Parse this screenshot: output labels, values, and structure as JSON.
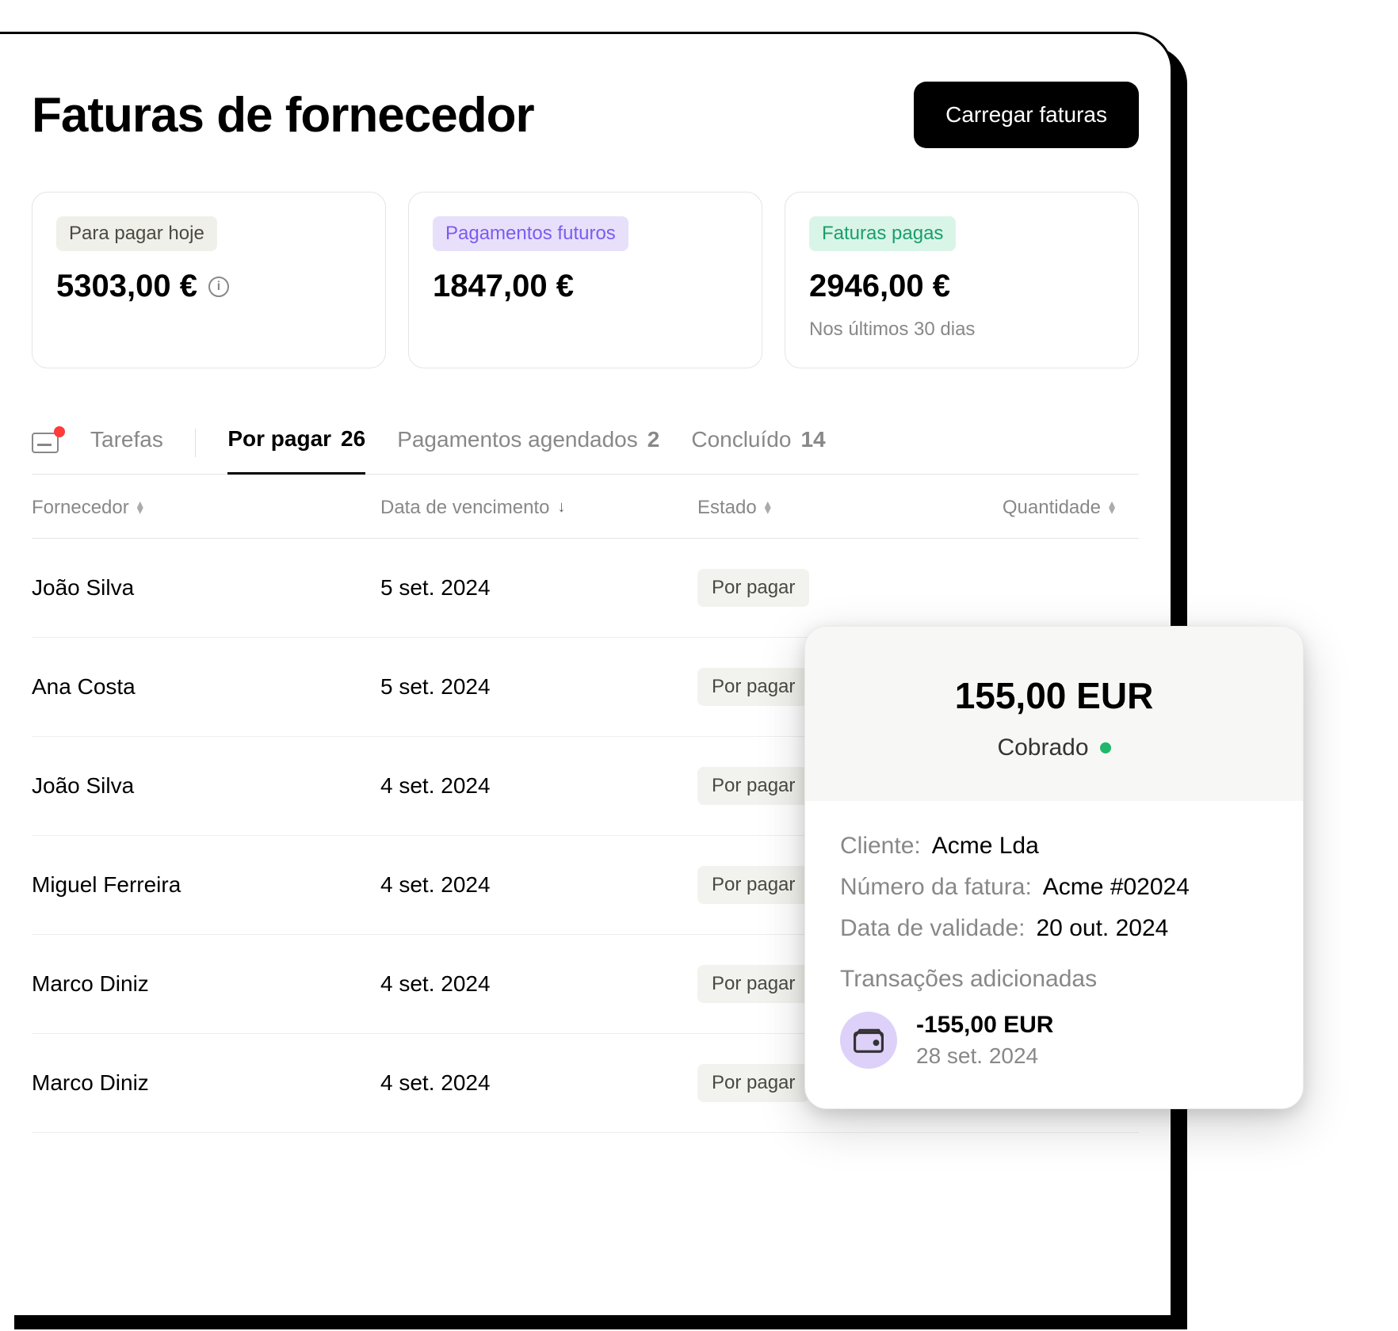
{
  "header": {
    "title": "Faturas de fornecedor",
    "upload_button": "Carregar faturas"
  },
  "summary": {
    "today": {
      "badge": "Para pagar hoje",
      "amount": "5303,00 €"
    },
    "future": {
      "badge": "Pagamentos futuros",
      "amount": "1847,00 €"
    },
    "paid": {
      "badge": "Faturas pagas",
      "amount": "2946,00 €",
      "sub": "Nos últimos 30 dias"
    }
  },
  "tabs": {
    "tasks": "Tarefas",
    "to_pay_label": "Por pagar",
    "to_pay_count": "26",
    "scheduled_label": "Pagamentos agendados",
    "scheduled_count": "2",
    "completed_label": "Concluído",
    "completed_count": "14"
  },
  "table": {
    "headers": {
      "supplier": "Fornecedor",
      "due": "Data de vencimento",
      "status": "Estado",
      "qty": "Quantidade"
    },
    "rows": [
      {
        "supplier": "João Silva",
        "due": "5 set. 2024",
        "status": "Por pagar"
      },
      {
        "supplier": "Ana Costa",
        "due": "5 set. 2024",
        "status": "Por pagar"
      },
      {
        "supplier": "João Silva",
        "due": "4 set. 2024",
        "status": "Por pagar"
      },
      {
        "supplier": "Miguel Ferreira",
        "due": "4 set. 2024",
        "status": "Por pagar"
      },
      {
        "supplier": "Marco Diniz",
        "due": "4 set. 2024",
        "status": "Por pagar"
      },
      {
        "supplier": "Marco Diniz",
        "due": "4 set. 2024",
        "status": "Por pagar"
      }
    ]
  },
  "detail": {
    "amount": "155,00 EUR",
    "status": "Cobrado",
    "client_label": "Cliente:",
    "client_value": "Acme Lda",
    "invoice_label": "Número da fatura:",
    "invoice_value": "Acme #02024",
    "expiry_label": "Data de validade:",
    "expiry_value": "20 out. 2024",
    "tx_title": "Transações adicionadas",
    "tx_amount": "-155,00 EUR",
    "tx_date": "28 set. 2024"
  }
}
